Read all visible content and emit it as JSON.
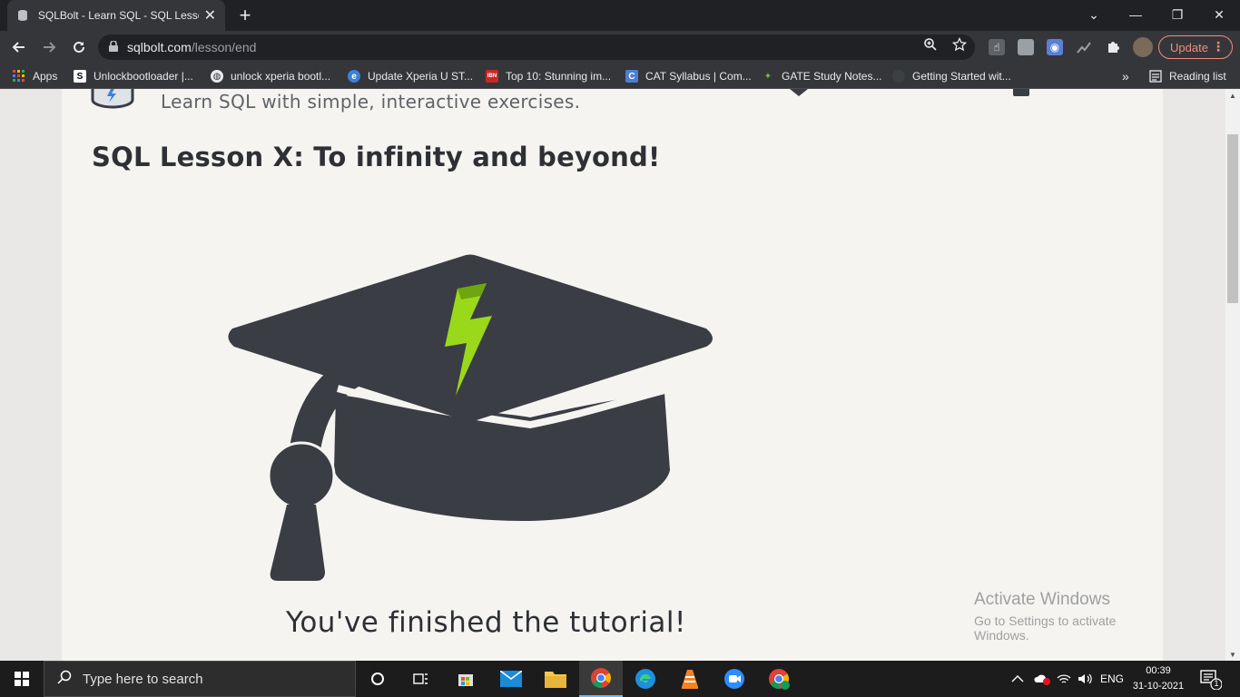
{
  "browser": {
    "tab_title": "SQLBolt - Learn SQL - SQL Lesson",
    "tab_close": "✕",
    "new_tab": "+",
    "url_host": "sqlbolt.com",
    "url_path": "/lesson/end",
    "update_label": "Update",
    "update_dots": "⋮",
    "win_minimize": "—",
    "win_restore": "❐",
    "win_close": "✕",
    "dropdown": "⌄"
  },
  "bookmarks": {
    "items": [
      {
        "label": "Apps"
      },
      {
        "label": "Unlockbootloader |..."
      },
      {
        "label": "unlock xperia bootl..."
      },
      {
        "label": "Update Xperia U ST..."
      },
      {
        "label": "Top 10: Stunning im..."
      },
      {
        "label": "CAT Syllabus | Com..."
      },
      {
        "label": "GATE Study Notes..."
      },
      {
        "label": "Getting Started wit..."
      }
    ],
    "overflow": "»",
    "reading_list": "Reading list"
  },
  "page": {
    "tagline": "Learn SQL with simple, interactive exercises.",
    "lesson_title": "SQL Lesson X: To infinity and beyond!",
    "finished_text": "You've finished the tutorial!"
  },
  "watermark": {
    "line1": "Activate Windows",
    "line2": "Go to Settings to activate Windows."
  },
  "taskbar": {
    "search_placeholder": "Type here to search",
    "language": "ENG",
    "time": "00:39",
    "date": "31-10-2021",
    "notification_count": "1"
  },
  "colors": {
    "cap_dark": "#3b3d44",
    "bolt_green": "#9ad81c",
    "accent_update": "#f28b82"
  }
}
